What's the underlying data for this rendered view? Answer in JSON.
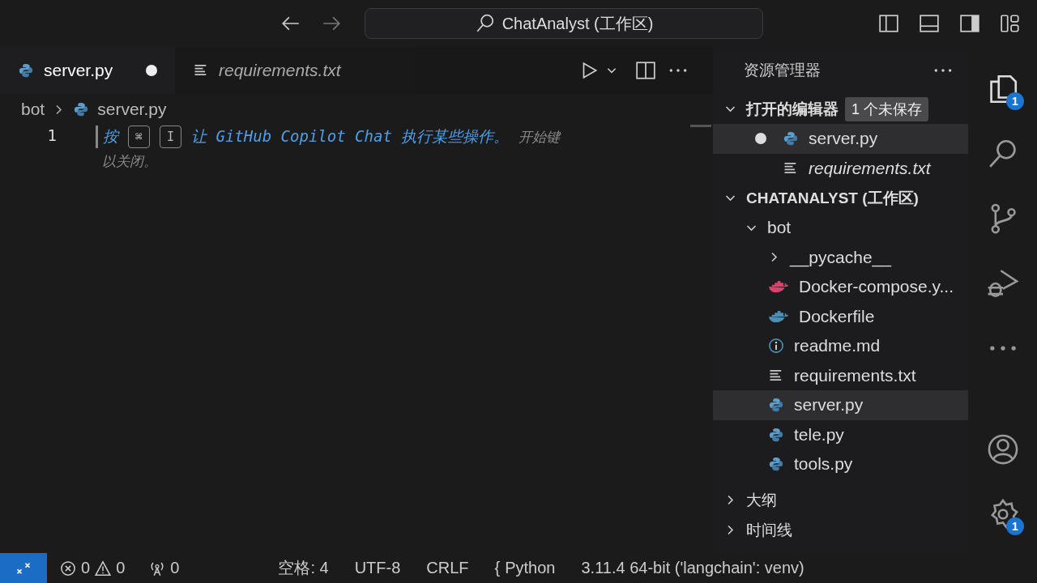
{
  "title_bar": {
    "search": "ChatAnalyst (工作区)"
  },
  "tabs": [
    {
      "label": "server.py",
      "kind": "python",
      "selected": true,
      "dirty": true,
      "italic": false
    },
    {
      "label": "requirements.txt",
      "kind": "text",
      "selected": false,
      "dirty": false,
      "italic": true
    }
  ],
  "breadcrumb": [
    {
      "label": "bot",
      "kind": "folder"
    },
    {
      "label": "server.py",
      "kind": "python"
    }
  ],
  "editor": {
    "line_numbers": [
      "1"
    ],
    "hint": {
      "prefix": "按",
      "keys": [
        "⌘",
        "I"
      ],
      "message": "让 GitHub Copilot Chat 执行某些操作。",
      "tail": "开始键",
      "second_line": "以关闭。"
    }
  },
  "explorer": {
    "title": "资源管理器",
    "open_editors": {
      "label": "打开的编辑器",
      "expanded": true,
      "badge": "1 个未保存",
      "items": [
        {
          "label": "server.py",
          "kind": "python",
          "dirty": true,
          "selected": true,
          "italic": false
        },
        {
          "label": "requirements.txt",
          "kind": "text",
          "dirty": false,
          "selected": false,
          "italic": true
        }
      ]
    },
    "workspace": {
      "label": "CHATANALYST (工作区)",
      "expanded": true,
      "tree": [
        {
          "label": "bot",
          "kind": "folder",
          "expanded": true,
          "selected": false,
          "children": [
            {
              "label": "__pycache__",
              "kind": "folder",
              "expanded": false,
              "selected": false
            },
            {
              "label": "Docker-compose.y...",
              "kind": "compose",
              "selected": false
            },
            {
              "label": "Dockerfile",
              "kind": "docker",
              "selected": false
            },
            {
              "label": "readme.md",
              "kind": "info",
              "selected": false
            },
            {
              "label": "requirements.txt",
              "kind": "text",
              "selected": false
            },
            {
              "label": "server.py",
              "kind": "python",
              "selected": true
            },
            {
              "label": "tele.py",
              "kind": "python",
              "selected": false
            },
            {
              "label": "tools.py",
              "kind": "python",
              "selected": false
            }
          ]
        }
      ]
    },
    "sections": [
      {
        "label": "大纲",
        "expanded": false
      },
      {
        "label": "时间线",
        "expanded": false
      }
    ]
  },
  "activity_bar": [
    {
      "kind": "files",
      "badge": "1"
    },
    {
      "kind": "search"
    },
    {
      "kind": "branch"
    },
    {
      "kind": "debug"
    },
    {
      "kind": "more"
    }
  ],
  "activity_bar_bottom": [
    {
      "kind": "account"
    },
    {
      "kind": "settings",
      "badge": "1"
    }
  ],
  "status_bar": [
    {
      "kind": "problems",
      "errors": "0",
      "warnings": "0"
    },
    {
      "kind": "ports",
      "text": "0"
    },
    {
      "kind": "text",
      "text": "空格: 4"
    },
    {
      "kind": "text",
      "text": "UTF-8"
    },
    {
      "kind": "text",
      "text": "CRLF"
    },
    {
      "kind": "language",
      "icon": "{",
      "text": "Python"
    },
    {
      "kind": "text",
      "text": "3.11.4 64-bit ('langchain': venv)"
    }
  ]
}
